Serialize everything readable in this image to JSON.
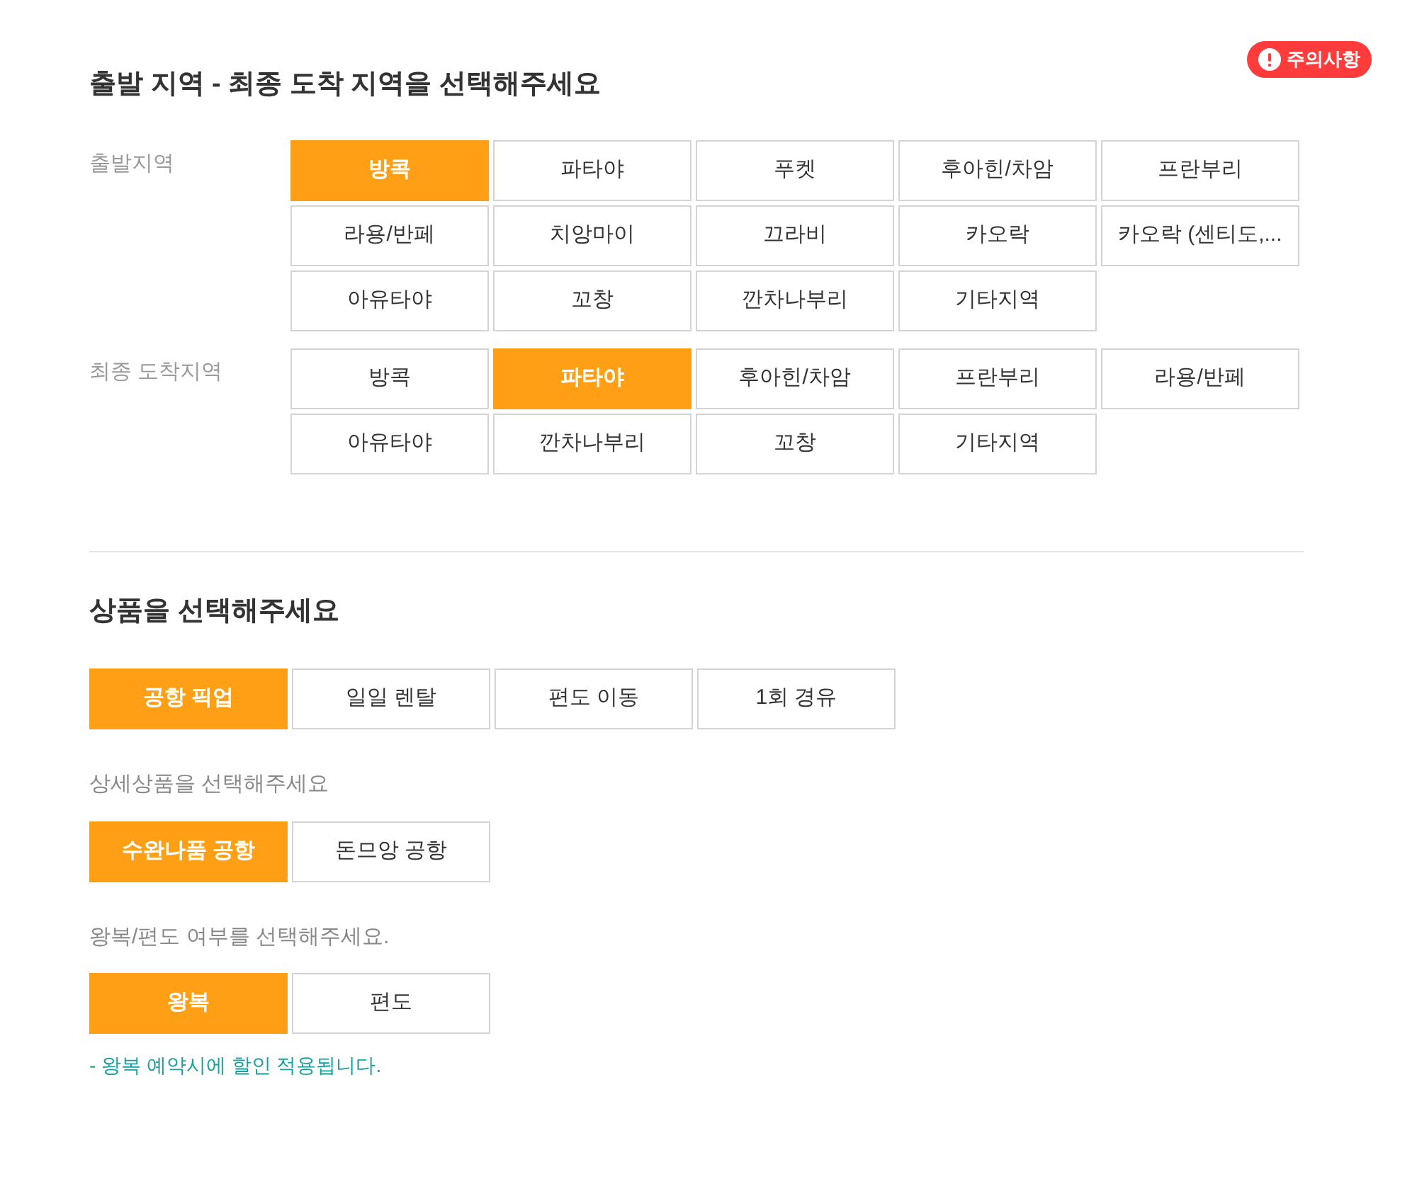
{
  "notice_badge": {
    "label": "주의사항"
  },
  "region_section": {
    "title": "출발 지역 - 최종 도착 지역을 선택해주세요",
    "groups": [
      {
        "label": "출발지역",
        "options": [
          {
            "label": "방콕",
            "selected": true
          },
          {
            "label": "파타야",
            "selected": false
          },
          {
            "label": "푸켓",
            "selected": false
          },
          {
            "label": "후아힌/차암",
            "selected": false
          },
          {
            "label": "프란부리",
            "selected": false
          },
          {
            "label": "라용/반페",
            "selected": false
          },
          {
            "label": "치앙마이",
            "selected": false
          },
          {
            "label": "끄라비",
            "selected": false
          },
          {
            "label": "카오락",
            "selected": false
          },
          {
            "label": "카오락 (센티도,...",
            "selected": false
          },
          {
            "label": "아유타야",
            "selected": false
          },
          {
            "label": "꼬창",
            "selected": false
          },
          {
            "label": "깐차나부리",
            "selected": false
          },
          {
            "label": "기타지역",
            "selected": false
          }
        ]
      },
      {
        "label": "최종 도착지역",
        "options": [
          {
            "label": "방콕",
            "selected": false
          },
          {
            "label": "파타야",
            "selected": true
          },
          {
            "label": "후아힌/차암",
            "selected": false
          },
          {
            "label": "프란부리",
            "selected": false
          },
          {
            "label": "라용/반페",
            "selected": false
          },
          {
            "label": "아유타야",
            "selected": false
          },
          {
            "label": "깐차나부리",
            "selected": false
          },
          {
            "label": "꼬창",
            "selected": false
          },
          {
            "label": "기타지역",
            "selected": false
          }
        ]
      }
    ]
  },
  "product_section": {
    "title": "상품을 선택해주세요",
    "products": [
      {
        "label": "공항 픽업",
        "selected": true
      },
      {
        "label": "일일 렌탈",
        "selected": false
      },
      {
        "label": "편도 이동",
        "selected": false
      },
      {
        "label": "1회 경유",
        "selected": false
      }
    ],
    "detail_label": "상세상품을 선택해주세요",
    "details": [
      {
        "label": "수완나품 공항",
        "selected": true
      },
      {
        "label": "돈므앙 공항",
        "selected": false
      }
    ],
    "trip_label": "왕복/편도 여부를 선택해주세요.",
    "trips": [
      {
        "label": "왕복",
        "selected": true
      },
      {
        "label": "편도",
        "selected": false
      }
    ],
    "note": "- 왕복 예약시에 할인 적용됩니다."
  }
}
